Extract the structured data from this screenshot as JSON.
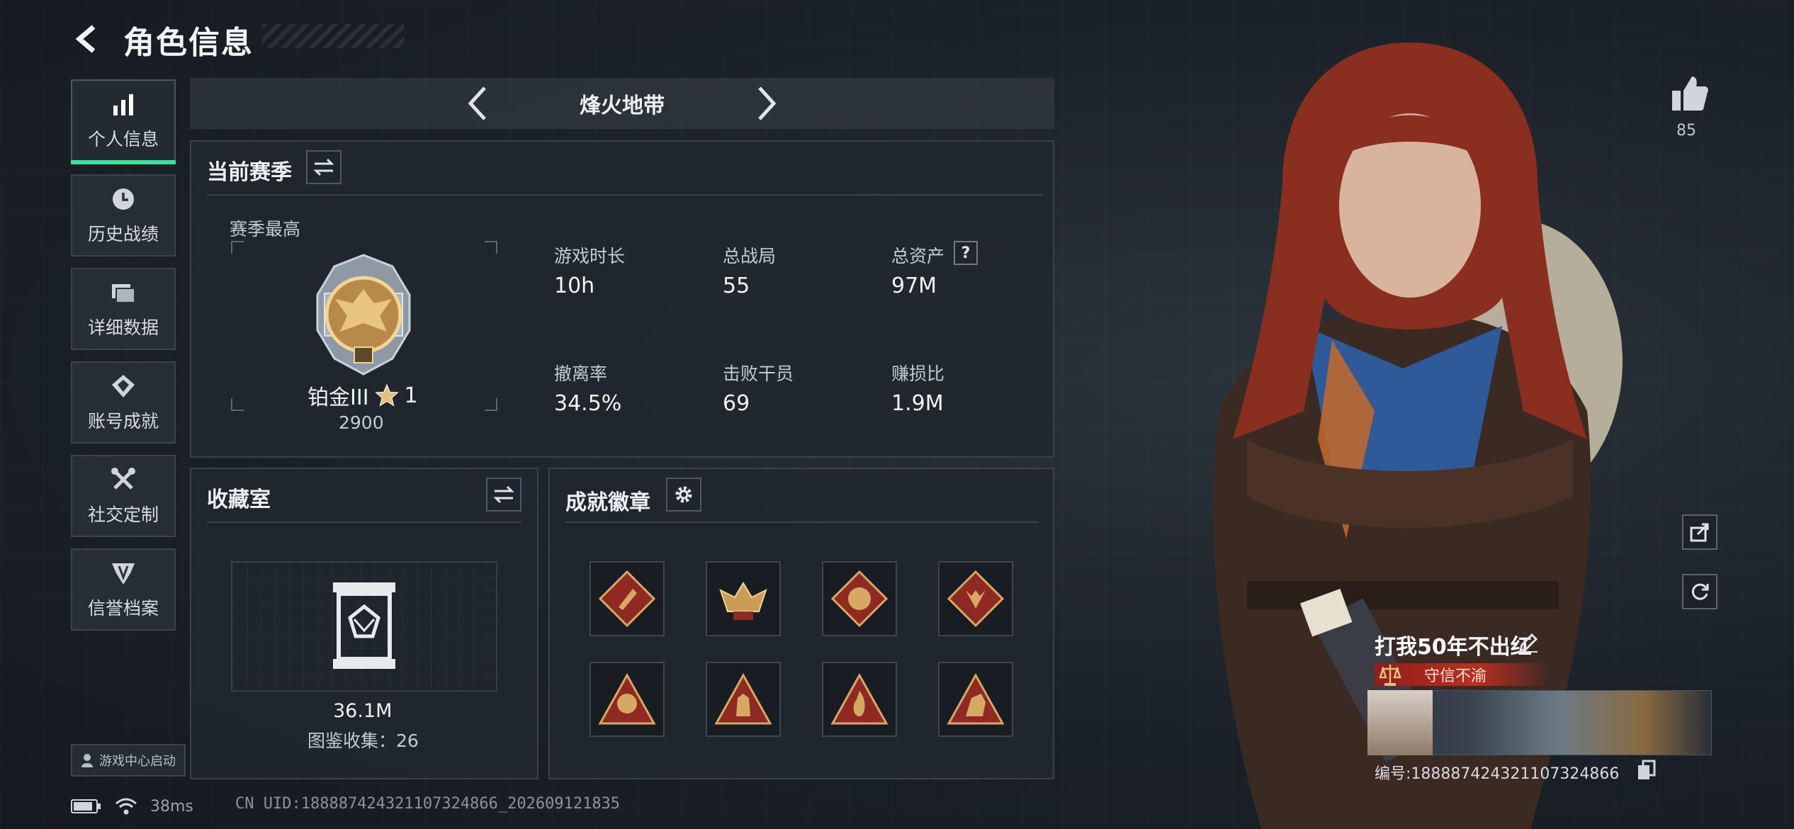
{
  "header": {
    "title": "角色信息"
  },
  "sidebar": {
    "items": [
      {
        "label": "个人信息",
        "icon": "bar-chart-icon",
        "active": true
      },
      {
        "label": "历史战绩",
        "icon": "clock-icon",
        "active": false
      },
      {
        "label": "详细数据",
        "icon": "folders-icon",
        "active": false
      },
      {
        "label": "账号成就",
        "icon": "medal-icon",
        "active": false
      },
      {
        "label": "社交定制",
        "icon": "tools-icon",
        "active": false
      },
      {
        "label": "信誉档案",
        "icon": "shield-emblem-icon",
        "active": false
      }
    ],
    "launch_label": "游戏中心启动"
  },
  "mode": {
    "title": "烽火地带"
  },
  "season": {
    "title": "当前赛季",
    "best_label": "赛季最高",
    "rank_name": "铂金III",
    "rank_stars": "1",
    "rank_points": "2900",
    "stats": [
      {
        "label": "游戏时长",
        "value": "10h"
      },
      {
        "label": "总战局",
        "value": "55"
      },
      {
        "label": "总资产",
        "value": "97M"
      },
      {
        "label": "撤离率",
        "value": "34.5%"
      },
      {
        "label": "击败干员",
        "value": "69"
      },
      {
        "label": "赚损比",
        "value": "1.9M"
      }
    ],
    "help_glyph": "?"
  },
  "collection": {
    "title": "收藏室",
    "value": "36.1M",
    "catalog_text": "图鉴收集：26"
  },
  "badges": {
    "title": "成就徽章",
    "items": [
      "badge-1",
      "badge-2",
      "badge-3",
      "badge-4",
      "badge-5",
      "badge-6",
      "badge-7",
      "badge-8"
    ]
  },
  "profile_card": {
    "name": "打我50年不出红",
    "title": "守信不渝",
    "id_text": "编号:18888742432110732486​6"
  },
  "likes": {
    "count": "85"
  },
  "status": {
    "ping": "38ms",
    "uid": "CN UID:18888742432110732486​6_202609121835"
  },
  "colors": {
    "accent": "#3fe09a",
    "gold": "#c8a45a",
    "red_banner": "#b82e24"
  }
}
